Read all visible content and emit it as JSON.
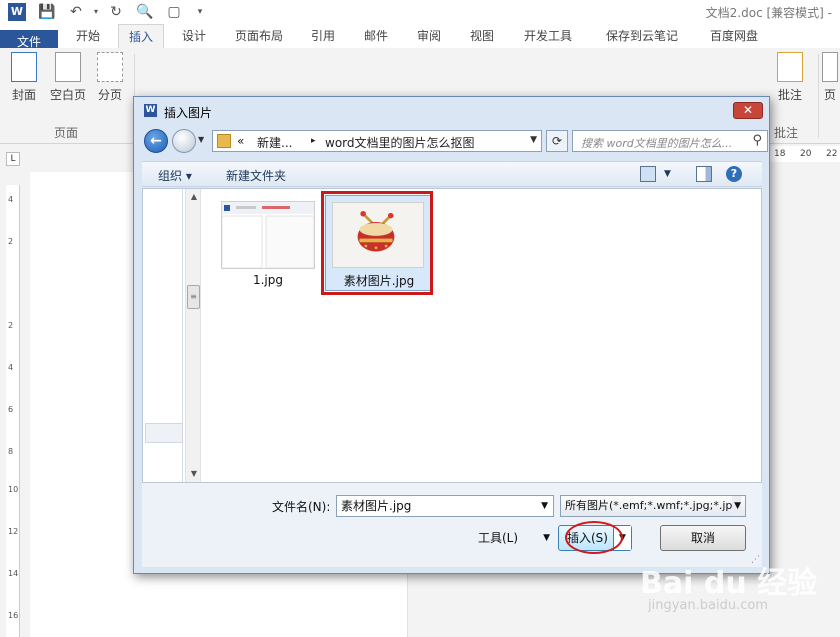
{
  "app": {
    "doc_title": "文档2.doc [兼容模式] -",
    "logo_letter": "W"
  },
  "ribbon": {
    "tabs": [
      "文件",
      "开始",
      "插入",
      "设计",
      "页面布局",
      "引用",
      "邮件",
      "审阅",
      "视图",
      "开发工具",
      "保存到云笔记",
      "百度网盘"
    ],
    "active_tab": "插入",
    "page_group": {
      "buttons": [
        "封面",
        "空白页",
        "分页"
      ],
      "label": "页面"
    },
    "right_group": {
      "button": "批注",
      "label": "批注"
    },
    "right_edge_label": "页"
  },
  "ruler": {
    "corner": "L",
    "vertical_labels": [
      "4",
      "2",
      "2",
      "4",
      "6",
      "8",
      "10",
      "12",
      "14",
      "16"
    ],
    "horizontal_labels": [
      "18",
      "20",
      "22"
    ]
  },
  "dialog": {
    "title": "插入图片",
    "close": "✕",
    "breadcrumb": [
      "«",
      "新建...",
      "▸",
      "word文档里的图片怎么抠图"
    ],
    "search_placeholder": "搜索 word文档里的图片怎么...",
    "toolbar": {
      "organize": "组织 ▾",
      "new_folder": "新建文件夹"
    },
    "files": [
      {
        "name": "1.jpg",
        "selected": false
      },
      {
        "name": "素材图片.jpg",
        "selected": true
      }
    ],
    "filename_label": "文件名(N):",
    "filename_value": "素材图片.jpg",
    "filter_value": "所有图片(*.emf;*.wmf;*.jpg;*.jp",
    "tools_label": "工具(L)",
    "insert_label": "插入(S)",
    "cancel_label": "取消"
  },
  "watermark": {
    "brand": "Bai du 经验",
    "url": "jingyan.baidu.com"
  },
  "colors": {
    "accent": "#2b579a",
    "highlight_red": "#cc1818"
  }
}
